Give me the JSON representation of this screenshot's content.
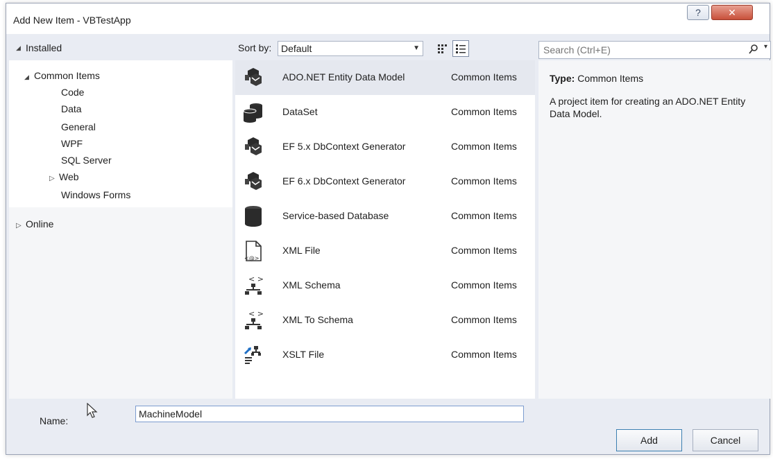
{
  "window": {
    "title": "Add New Item - VBTestApp",
    "help_label": "?",
    "close_label": "✕"
  },
  "left": {
    "installed_label": "Installed",
    "tree": [
      {
        "label": "Common Items",
        "expanded": true
      },
      {
        "label": "Code"
      },
      {
        "label": "Data",
        "selected": true
      },
      {
        "label": "General"
      },
      {
        "label": "WPF"
      },
      {
        "label": "SQL Server"
      },
      {
        "label": "Web",
        "collapsed": true
      },
      {
        "label": "Windows Forms"
      }
    ],
    "online_label": "Online"
  },
  "sort": {
    "label": "Sort by:",
    "value": "Default"
  },
  "items": [
    {
      "name": "ADO.NET Entity Data Model",
      "category": "Common Items",
      "icon": "entity-model-icon"
    },
    {
      "name": "DataSet",
      "category": "Common Items",
      "icon": "dataset-icon"
    },
    {
      "name": "EF 5.x DbContext Generator",
      "category": "Common Items",
      "icon": "entity-model-icon"
    },
    {
      "name": "EF 6.x DbContext Generator",
      "category": "Common Items",
      "icon": "entity-model-icon"
    },
    {
      "name": "Service-based Database",
      "category": "Common Items",
      "icon": "database-icon"
    },
    {
      "name": "XML File",
      "category": "Common Items",
      "icon": "xml-file-icon"
    },
    {
      "name": "XML Schema",
      "category": "Common Items",
      "icon": "xml-schema-icon"
    },
    {
      "name": "XML To Schema",
      "category": "Common Items",
      "icon": "xml-schema-icon"
    },
    {
      "name": "XSLT File",
      "category": "Common Items",
      "icon": "xslt-file-icon"
    }
  ],
  "search": {
    "placeholder": "Search (Ctrl+E)"
  },
  "details": {
    "type_label": "Type:",
    "type_value": "Common Items",
    "description": "A project item for creating an ADO.NET Entity Data Model."
  },
  "bottom": {
    "name_label": "Name:",
    "name_value": "MachineModel",
    "add_label": "Add",
    "cancel_label": "Cancel"
  },
  "colors": {
    "selected_row": "#e5e8ef",
    "window_bg": "#e9ecf3",
    "close_button": "#c8503a"
  }
}
